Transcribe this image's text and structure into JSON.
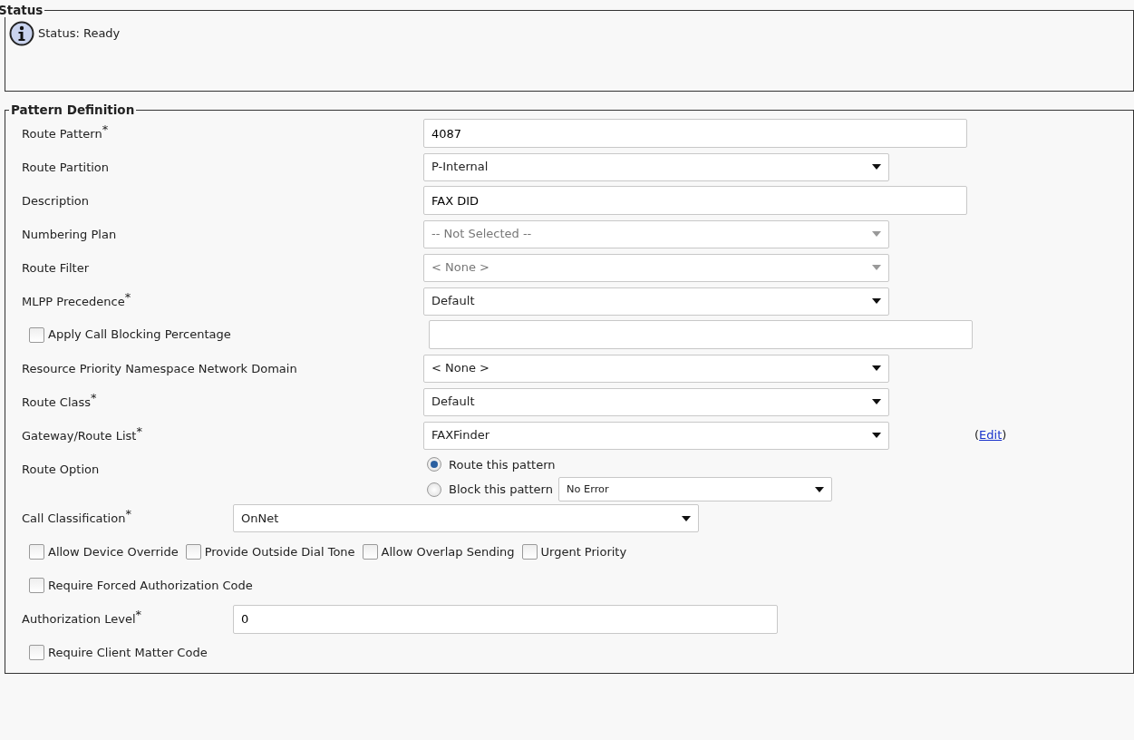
{
  "status": {
    "title": "Status",
    "message": "Status: Ready"
  },
  "pattern_definition": {
    "title": "Pattern Definition",
    "fields": [
      {
        "kind": "text",
        "label": "Route Pattern$^{*}$",
        "value": "4087"
      },
      {
        "kind": "select",
        "label": "Route Partition",
        "value": "P-Internal",
        "disabled": false
      },
      {
        "kind": "text",
        "label": "Description",
        "value": "FAX DID"
      },
      {
        "kind": "select",
        "label": "Numbering Plan",
        "value": "-- Not Selected --",
        "disabled": true
      },
      {
        "kind": "select",
        "label": "Route Filter",
        "value": "< None >",
        "disabled": true
      },
      {
        "kind": "select",
        "label": "MLPP Precedence$^{*}$",
        "value": "Default",
        "disabled": false
      },
      {
        "kind": "check_text",
        "label": "Apply Call Blocking Percentage",
        "checked": false
      },
      {
        "kind": "select",
        "label": "Resource Priority Namespace Network Domain",
        "value": "< None >",
        "disabled": false
      },
      {
        "kind": "select",
        "label": "Route Class$^{*}$",
        "value": "Default",
        "disabled": false
      },
      {
        "kind": "select",
        "label": "Gateway/Route List$^{*}$",
        "value": "FAXFinder",
        "disabled": false,
        "link": {
          "before": "(",
          "label": "Edit",
          "after": ")"
        }
      },
      {
        "kind": "radio",
        "label": "Route Option",
        "options": [
          {
            "label": "Route this pattern",
            "selected": true
          },
          {
            "label": "Block this pattern",
            "selected": false,
            "select_value": "No Error"
          }
        ]
      },
      {
        "kind": "short_select",
        "label": "Call Classification$^{*}$",
        "value": "OnNet",
        "disabled": false
      },
      {
        "kind": "checks",
        "options": [
          {
            "label": "Allow Device Override",
            "checked": false
          },
          {
            "label": "Provide Outside Dial Tone",
            "checked": false
          },
          {
            "label": "Allow Overlap Sending",
            "checked": false
          },
          {
            "label": "Urgent Priority",
            "checked": false
          }
        ]
      },
      {
        "kind": "checks",
        "options": [
          {
            "label": "Require Forced Authorization Code",
            "checked": false
          }
        ]
      },
      {
        "kind": "short_text",
        "label": "Authorization Level$^{*}$",
        "value": "0"
      },
      {
        "kind": "checks",
        "options": [
          {
            "label": "Require Client Matter Code",
            "checked": false
          }
        ]
      }
    ]
  }
}
